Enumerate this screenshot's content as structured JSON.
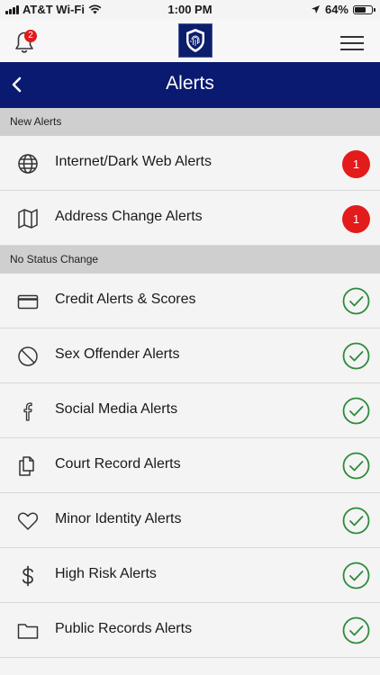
{
  "status_bar": {
    "carrier": "AT&T Wi-Fi",
    "time": "1:00 PM",
    "battery": "64%",
    "battery_level": 0.64
  },
  "header": {
    "notification_count": "2",
    "logo_icon": "fingerprint-shield-icon",
    "menu_icon": "hamburger-icon"
  },
  "nav": {
    "title": "Alerts",
    "back_icon": "chevron-left-icon"
  },
  "sections": {
    "new_alerts": {
      "title": "New Alerts",
      "items": [
        {
          "label": "Internet/Dark Web Alerts",
          "icon": "globe-icon",
          "count": "1"
        },
        {
          "label": "Address Change Alerts",
          "icon": "map-icon",
          "count": "1"
        }
      ]
    },
    "no_status_change": {
      "title": "No Status Change",
      "items": [
        {
          "label": "Credit Alerts & Scores",
          "icon": "credit-card-icon",
          "status": "check"
        },
        {
          "label": "Sex Offender Alerts",
          "icon": "prohibited-icon",
          "status": "check"
        },
        {
          "label": "Social Media Alerts",
          "icon": "facebook-icon",
          "status": "check"
        },
        {
          "label": "Court Record Alerts",
          "icon": "documents-icon",
          "status": "check"
        },
        {
          "label": "Minor Identity Alerts",
          "icon": "heart-icon",
          "status": "check"
        },
        {
          "label": "High Risk Alerts",
          "icon": "dollar-icon",
          "status": "check"
        },
        {
          "label": "Public Records Alerts",
          "icon": "folder-icon",
          "status": "check"
        }
      ]
    }
  },
  "colors": {
    "nav_background": "#0a1a70",
    "alert_red": "#e31b1b",
    "check_green": "#2e8b3a",
    "section_gray": "#cfcfcf"
  }
}
